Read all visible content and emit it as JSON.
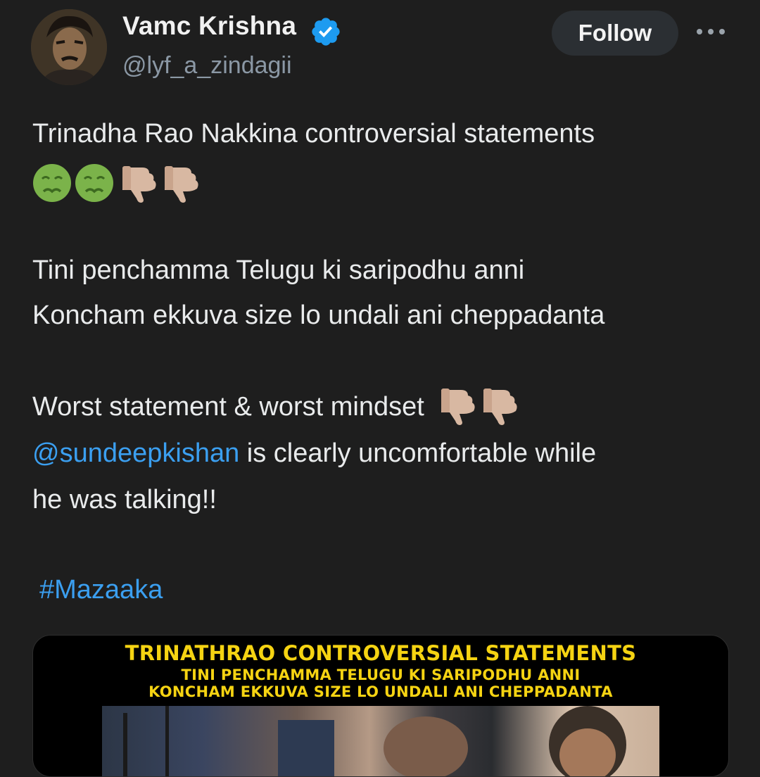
{
  "user": {
    "name": "Vamc Krishna",
    "handle": "@lyf_a_zindagii",
    "verified": true,
    "follow_label": "Follow"
  },
  "tweet": {
    "line1": "Trinadha Rao Nakkina controversial statements",
    "emoji_line": [
      "nauseated-face",
      "nauseated-face",
      "thumbs-down",
      "thumbs-down"
    ],
    "line2": "Tini penchamma Telugu ki saripodhu anni",
    "line3": "Koncham ekkuva size lo undali ani cheppadanta",
    "line4": "Worst statement & worst mindset",
    "mention": "@sundeepkishan",
    "line5_rest": " is clearly uncomfortable while",
    "line6": "he was talking!!",
    "hashtag": "#Mazaaka"
  },
  "media": {
    "title": "TRINATHRAO CONTROVERSIAL STATEMENTS",
    "sub1": "TINI PENCHAMMA TELUGU KI SARIPODHU ANNI",
    "sub2": "KONCHAM EKKUVA SIZE LO UNDALI ANI CHEPPADANTA"
  },
  "colors": {
    "background": "#1e1e1e",
    "link": "#3b9ff0",
    "verified": "#1d9bf0",
    "media_text": "#f5d312"
  }
}
